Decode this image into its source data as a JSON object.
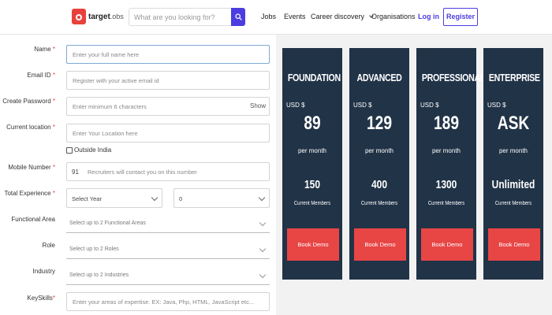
{
  "header": {
    "logo_text_bold": "target",
    "logo_text_rest": ".obs",
    "search_placeholder": "What are you looking for?",
    "nav": {
      "jobs": "Jobs",
      "events": "Events",
      "career_discovery": "Career discovery",
      "organisations": "Organisations",
      "login": "Log in",
      "register": "Register"
    }
  },
  "form": {
    "name": {
      "label": "Name",
      "placeholder": "Enter your full name here"
    },
    "email": {
      "label": "Email ID",
      "placeholder": "Register with your active email id"
    },
    "password": {
      "label": "Create Password",
      "placeholder": "Enter minimum 6 characters",
      "show": "Show"
    },
    "location": {
      "label": "Current location",
      "placeholder": "Enter Your Location here",
      "outside_india": "Outside India"
    },
    "mobile": {
      "label": "Mobile Number",
      "code": "91",
      "placeholder": "Recruiters will contact you on this number"
    },
    "experience": {
      "label": "Total Experience",
      "year_value": "Select Year",
      "month_value": "0"
    },
    "functional_area": {
      "label": "Functional Area",
      "placeholder": "Select up to 2 Functional Areas"
    },
    "role": {
      "label": "Role",
      "placeholder": "Select up to 2 Roles"
    },
    "industry": {
      "label": "Industry",
      "placeholder": "Select up to 2 Industries"
    },
    "keyskills": {
      "label": "KeySkills",
      "placeholder": "Enter your areas of expertise. EX: Java, Php, HTML, JavaScript etc..."
    },
    "required_mark": "*"
  },
  "pricing": {
    "plans": [
      {
        "name": "FOUNDATION",
        "currency": "USD $",
        "price": "89",
        "period": "per month",
        "members": "150",
        "members_label": "Current Members",
        "button": "Book Demo"
      },
      {
        "name": "ADVANCED",
        "currency": "USD $",
        "price": "129",
        "period": "per month",
        "members": "400",
        "members_label": "Current Members",
        "button": "Book Demo"
      },
      {
        "name": "PROFESSIONAL",
        "currency": "USD $",
        "price": "189",
        "period": "per month",
        "members": "1300",
        "members_label": "Current Members",
        "button": "Book Demo"
      },
      {
        "name": "ENTERPRISE",
        "currency": "USD $",
        "price": "ASK",
        "period": "per month",
        "members": "Unlimited",
        "members_label": "Current Members",
        "button": "Book Demo"
      }
    ]
  },
  "colors": {
    "brand": "#e8413b",
    "accent": "#4b3de0",
    "plan_bg": "#213347",
    "demo_btn": "#e84545"
  }
}
